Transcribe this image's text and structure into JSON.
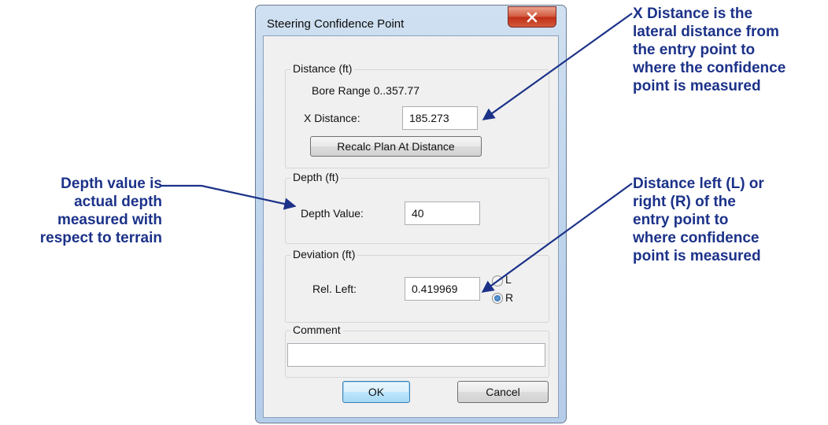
{
  "dialog": {
    "title": "Steering Confidence Point",
    "close_label": "X",
    "distance_group": {
      "legend": "Distance (ft)",
      "bore_range": "Bore Range 0..357.77",
      "x_distance_label": "X Distance:",
      "x_distance_value": "185.273",
      "recalc_button": "Recalc Plan At Distance"
    },
    "depth_group": {
      "legend": "Depth (ft)",
      "depth_label": "Depth Value:",
      "depth_value": "40"
    },
    "deviation_group": {
      "legend": "Deviation (ft)",
      "rel_left_label": "Rel. Left:",
      "rel_left_value": "0.419969",
      "radio_l_label": "L",
      "radio_r_label": "R",
      "selected_side": "R"
    },
    "comment_group": {
      "legend": "Comment",
      "comment_value": ""
    },
    "ok_button": "OK",
    "cancel_button": "Cancel"
  },
  "annotations": {
    "x_distance": [
      "X Distance is the",
      "lateral distance from",
      "the entry point to",
      "where the confidence",
      "point is measured"
    ],
    "depth": [
      "Depth value is",
      "actual depth",
      "measured with",
      "respect to terrain"
    ],
    "deviation": [
      "Distance left (L) or",
      "right (R) of the",
      "entry point to",
      "where confidence",
      "point is measured"
    ]
  },
  "colors": {
    "annotation_text": "#1c3289",
    "window_frame": "#bcd3ec",
    "close_button": "#c7402a"
  }
}
